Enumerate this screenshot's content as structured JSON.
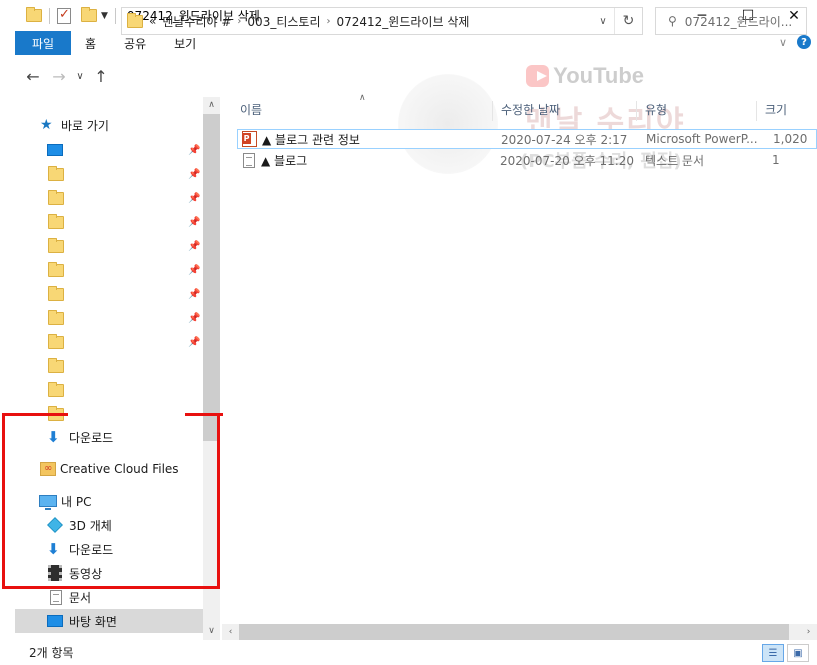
{
  "window": {
    "title": "072412_윈드라이브 삭제"
  },
  "ribbon": {
    "tabs": [
      "파일",
      "홈",
      "공유",
      "보기"
    ]
  },
  "address": {
    "crumbs": [
      "«",
      "맨날수리야 #",
      "003_티스토리",
      "072412_윈드라이브 삭제"
    ],
    "search_placeholder": "072412_윈드라이..."
  },
  "nav": {
    "quick_access": "바로 가기",
    "downloads_qa": "다운로드",
    "creative_cloud": "Creative Cloud Files",
    "this_pc": "내 PC",
    "objects3d": "3D 개체",
    "downloads": "다운로드",
    "videos": "동영상",
    "documents": "문서",
    "desktop": "바탕 화면"
  },
  "columns": {
    "name": "이름",
    "date": "수정한 날짜",
    "type": "유형",
    "size": "크기"
  },
  "files": [
    {
      "name": "▲ 블로그 관련 정보",
      "date": "2020-07-24 오후 2:17",
      "type": "Microsoft PowerP...",
      "size": "1,020",
      "icon": "powerpoint-icon"
    },
    {
      "name": "▲ 블로그",
      "date": "2020-07-20 오후 11:20",
      "type": "텍스트 문서",
      "size": "1",
      "icon": "text-document-icon"
    }
  ],
  "watermark": {
    "youtube": "YouTube",
    "line1": "맨날 수리야",
    "line2": "(PC부품 수리, 편집)"
  },
  "status": {
    "item_count": "2개 항목"
  },
  "colors": {
    "accent": "#1979ca",
    "highlight": "#e8100f",
    "selected": "#d9d9d9"
  }
}
